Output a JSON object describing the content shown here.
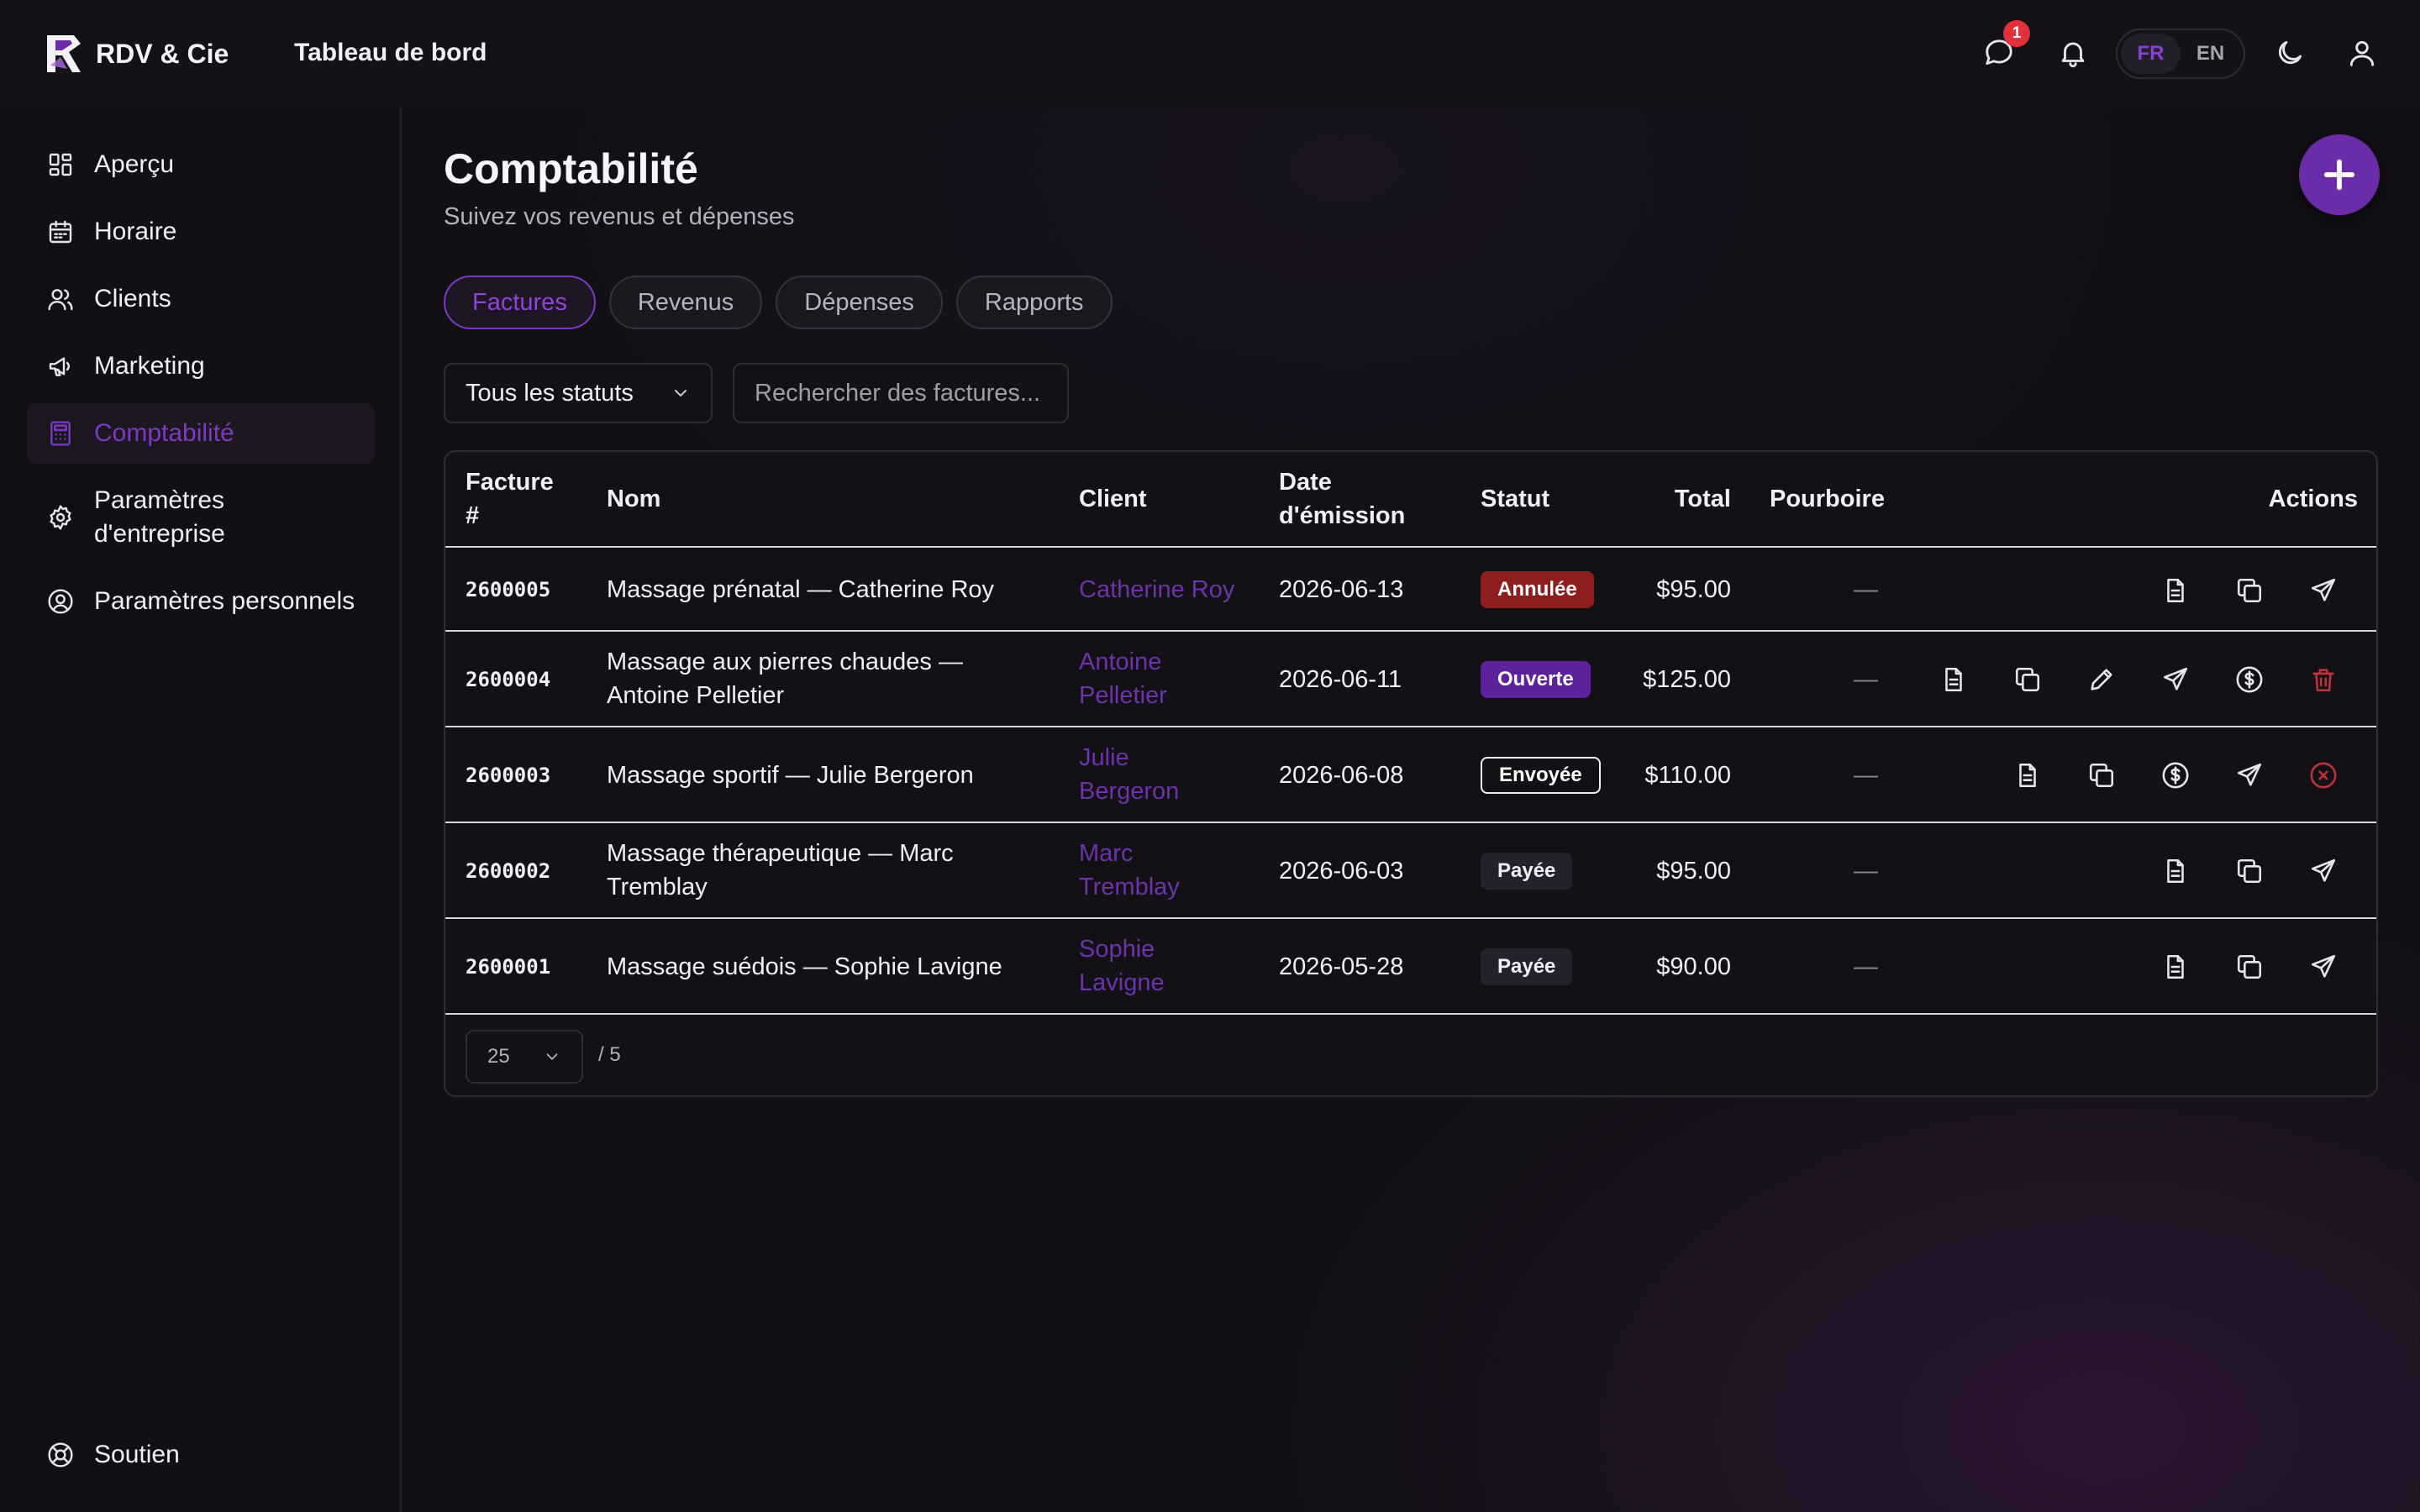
{
  "app": {
    "brand": "RDV & Cie",
    "header_title": "Tableau de bord"
  },
  "topbar": {
    "messages_badge": "1",
    "languages": [
      "FR",
      "EN"
    ],
    "active_language": "FR",
    "icons": [
      "message-icon",
      "bell-icon",
      "moon-icon",
      "user-icon"
    ]
  },
  "sidebar": {
    "items": [
      {
        "label": "Aperçu",
        "icon": "grid-icon"
      },
      {
        "label": "Horaire",
        "icon": "calendar-icon"
      },
      {
        "label": "Clients",
        "icon": "users-icon"
      },
      {
        "label": "Marketing",
        "icon": "megaphone-icon"
      },
      {
        "label": "Comptabilité",
        "icon": "calculator-icon",
        "active": true
      },
      {
        "label": "Paramètres d'entreprise",
        "icon": "gear-icon"
      },
      {
        "label": "Paramètres personnels",
        "icon": "user-circle-icon"
      }
    ],
    "support": {
      "label": "Soutien",
      "icon": "lifebuoy-icon"
    }
  },
  "page": {
    "title": "Comptabilité",
    "subtitle": "Suivez vos revenus et dépenses",
    "tabs": [
      "Factures",
      "Revenus",
      "Dépenses",
      "Rapports"
    ],
    "active_tab": "Factures"
  },
  "filters": {
    "status_value": "Tous les statuts",
    "search_placeholder": "Rechercher des factures..."
  },
  "table": {
    "headers": {
      "invoice": "Facture #",
      "name": "Nom",
      "client": "Client",
      "date": "Date d'émission",
      "status": "Statut",
      "total": "Total",
      "tip": "Pourboire",
      "actions": "Actions"
    },
    "rows": [
      {
        "id": "2600005",
        "name": "Massage prénatal — Catherine Roy",
        "client": "Catherine Roy",
        "date": "2026-06-13",
        "status": "Annulée",
        "total": "$95.00",
        "tip": "—"
      },
      {
        "id": "2600004",
        "name": "Massage aux pierres chaudes — Antoine Pelletier",
        "client": "Antoine Pelletier",
        "date": "2026-06-11",
        "status": "Ouverte",
        "total": "$125.00",
        "tip": "—"
      },
      {
        "id": "2600003",
        "name": "Massage sportif — Julie Bergeron",
        "client": "Julie Bergeron",
        "date": "2026-06-08",
        "status": "Envoyée",
        "total": "$110.00",
        "tip": "—"
      },
      {
        "id": "2600002",
        "name": "Massage thérapeutique — Marc Tremblay",
        "client": "Marc Tremblay",
        "date": "2026-06-03",
        "status": "Payée",
        "total": "$95.00",
        "tip": "—"
      },
      {
        "id": "2600001",
        "name": "Massage suédois — Sophie Lavigne",
        "client": "Sophie Lavigne",
        "date": "2026-05-28",
        "status": "Payée",
        "total": "$90.00",
        "tip": "—"
      }
    ],
    "row_actions": [
      [
        "document-icon",
        "copy-icon",
        "send-icon"
      ],
      [
        "document-icon",
        "copy-icon",
        "pencil-icon",
        "send-icon",
        "dollar-icon",
        "trash-icon"
      ],
      [
        "document-icon",
        "copy-icon",
        "dollar-icon",
        "send-icon",
        "cancel-icon"
      ],
      [
        "document-icon",
        "copy-icon",
        "send-icon"
      ],
      [
        "document-icon",
        "copy-icon",
        "send-icon"
      ]
    ]
  },
  "pagination": {
    "page_size": "25",
    "pages": "/ 5"
  },
  "colors": {
    "accent": "#6a2ca8",
    "annulee": "#8e1e1e",
    "ouverte": "#5b2299",
    "notification": "#e0313d",
    "background": "#121015"
  }
}
